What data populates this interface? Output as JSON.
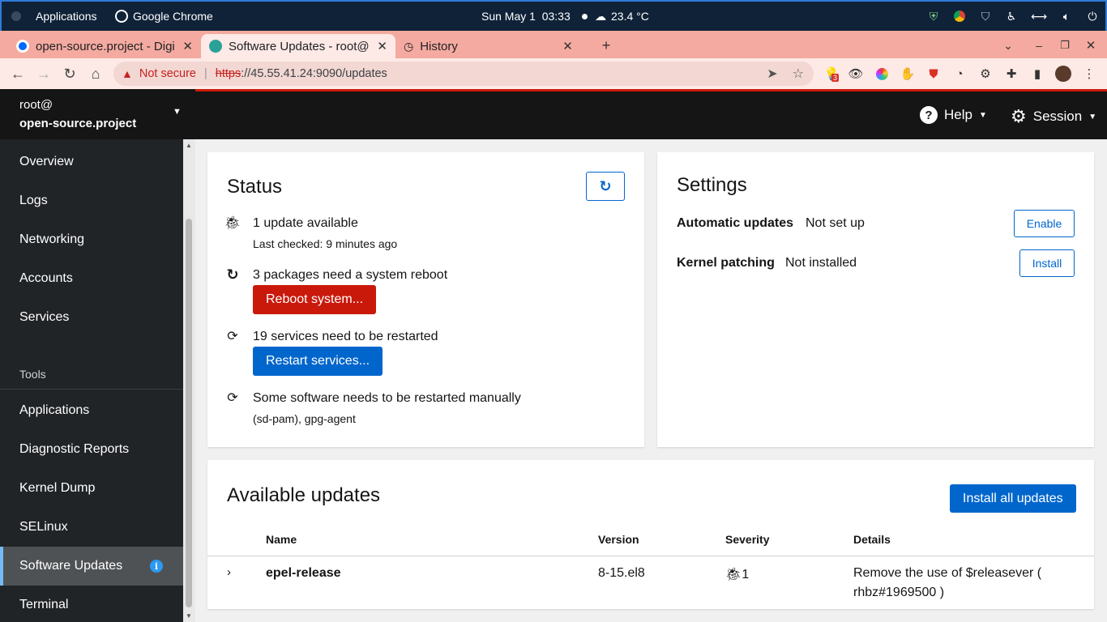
{
  "os_topbar": {
    "activities_label": "Applications",
    "app_label": "Google Chrome",
    "clock": "Sun May 1  03:33",
    "weather": "23.4 °C"
  },
  "browser": {
    "tabs": [
      {
        "title": "open-source.project - Digi",
        "active": false
      },
      {
        "title": "Software Updates - root@",
        "active": true
      },
      {
        "title": "History",
        "active": false
      }
    ],
    "new_tab_glyph": "+",
    "security_label": "Not secure",
    "url_protocol": "https",
    "url_rest": "://45.55.41.24:9090/updates",
    "extension_badge": "3"
  },
  "cockpit": {
    "host_user": "root@",
    "host_name": "open-source.project",
    "nav": {
      "overview": "Overview",
      "logs": "Logs",
      "networking": "Networking",
      "accounts": "Accounts",
      "services": "Services",
      "tools_header": "Tools",
      "applications": "Applications",
      "diagnostic_reports": "Diagnostic Reports",
      "kernel_dump": "Kernel Dump",
      "selinux": "SELinux",
      "software_updates": "Software Updates",
      "terminal": "Terminal"
    },
    "masthead": {
      "help_label": "Help",
      "session_label": "Session"
    },
    "status": {
      "title": "Status",
      "update_count": "1 update available",
      "last_checked": "Last checked: 9 minutes ago",
      "reboot_needed": "3 packages need a system reboot",
      "reboot_button": "Reboot system...",
      "services_needed": "19 services need to be restarted",
      "restart_button": "Restart services...",
      "manual_restart": "Some software needs to be restarted manually",
      "manual_list": "(sd-pam), gpg-agent"
    },
    "settings": {
      "title": "Settings",
      "auto_updates_label": "Automatic updates",
      "auto_updates_value": "Not set up",
      "enable_button": "Enable",
      "kernel_patching_label": "Kernel patching",
      "kernel_patching_value": "Not installed",
      "install_button": "Install"
    },
    "updates": {
      "title": "Available updates",
      "install_all_button": "Install all updates",
      "columns": {
        "name": "Name",
        "version": "Version",
        "severity": "Severity",
        "details": "Details"
      },
      "rows": [
        {
          "name": "epel-release",
          "version": "8-15.el8",
          "severity_count": "1",
          "details_line1": "Remove the use of $releasever (",
          "details_line2": "rhbz#1969500 )"
        }
      ]
    }
  },
  "colors": {
    "accent_blue": "#0066cc",
    "danger_red": "#c9190b",
    "sidebar_bg": "#212427",
    "masthead_bg": "#151515",
    "tabstrip_bg": "#f4aaa0"
  }
}
